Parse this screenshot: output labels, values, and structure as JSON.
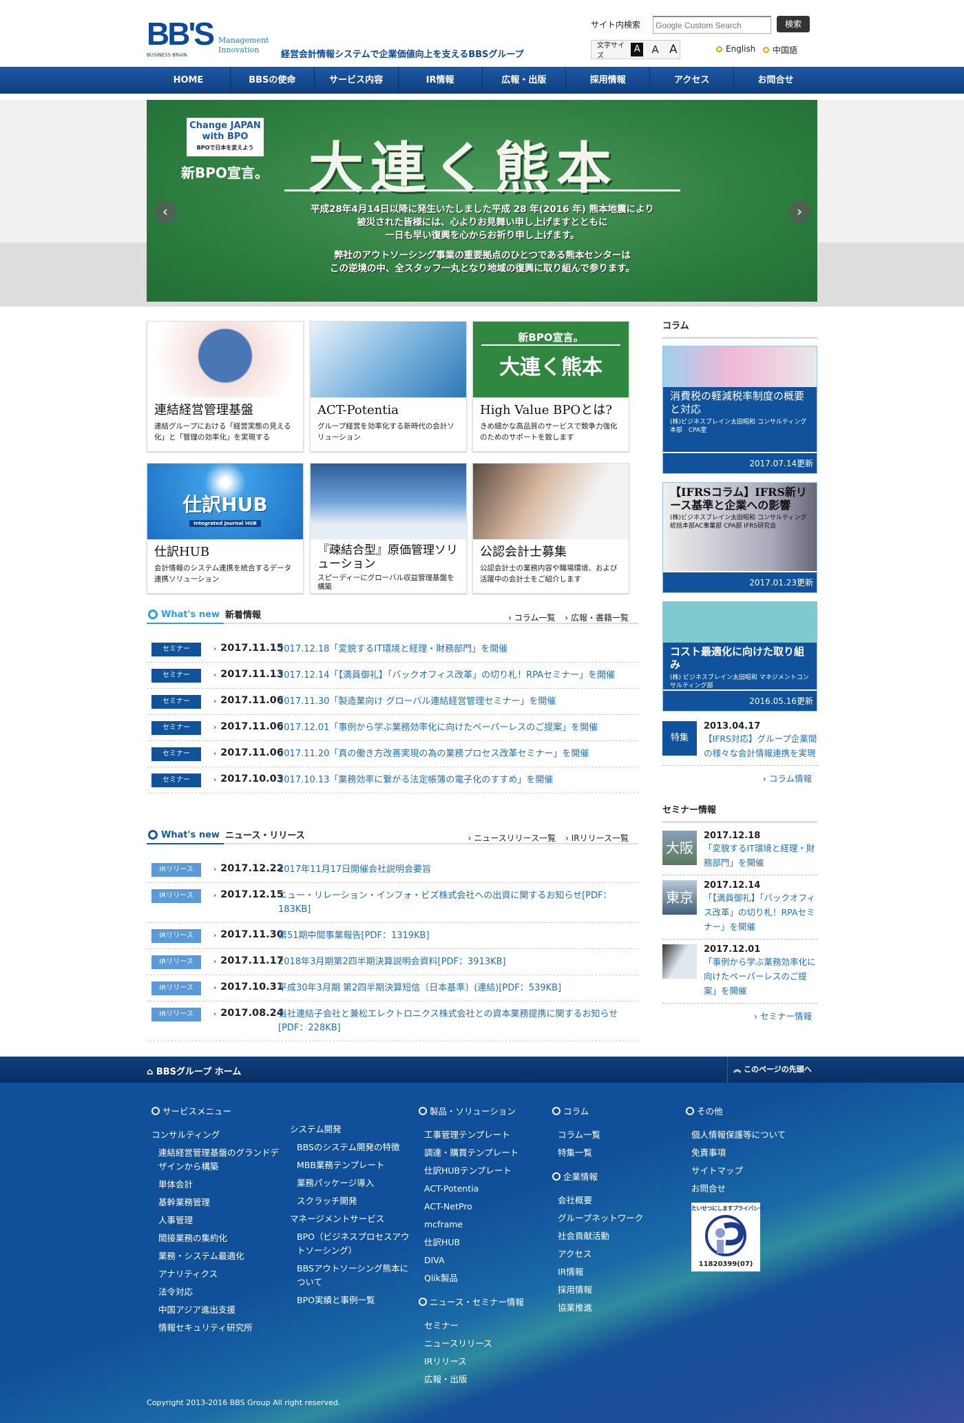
{
  "header": {
    "logo_text": "BB'S",
    "logo_sub": "BUSINESS BRAIN",
    "logo_tag": "Management Innovation",
    "tagline": "経営会計情報システムで企業価値向上を支えるBBSグループ",
    "search_label": "サイト内検索",
    "search_placeholder": "Google Custom Search",
    "search_button": "検索",
    "font_size_label": "文字サイズ",
    "font_sizes": [
      "A",
      "A",
      "A"
    ],
    "lang_en": "English",
    "lang_cn": "中国語"
  },
  "nav": [
    "HOME",
    "BBSの使命",
    "サービス内容",
    "IR情報",
    "広報・出版",
    "採用情報",
    "アクセス",
    "お問合せ"
  ],
  "hero": {
    "badge_line1": "Change JAPAN",
    "badge_line2": "with BPO",
    "badge_small": "BPOで日本を変えよう",
    "sub_title": "新BPO宣言。",
    "title": "大連く熊本",
    "message_1": "平成28年4月14日以降に発生いたしました平成 28 年(2016 年) 熊本地震により",
    "message_2": "被災された皆様には、心よりお見舞い申し上げますとともに",
    "message_3": "一日も早い復興を心からお祈り申し上げます。",
    "message_4": "弊社のアウトソーシング事業の重要拠点のひとつである熊本センターは",
    "message_5": "この逆境の中、全スタッフ一丸となり地域の復興に取り組んで参ります。",
    "prev": "‹",
    "next": "›",
    "slide_count": 8,
    "active_slide": 2
  },
  "tiles": [
    {
      "title": "連結経営管理基盤",
      "desc": "連結グループにおける「経営実態の見える化」と「管理の効率化」を実現する"
    },
    {
      "title": "ACT-Potentia",
      "desc": "グループ経営を効率化する新時代の会計ソリューション"
    },
    {
      "title": "High Value BPOとは?",
      "desc": "きめ細かな高品質のサービスで競争力強化のためのサポートを致します",
      "img_text_1": "新BPO宣言。",
      "img_text_2": "大連く熊本"
    },
    {
      "title": "仕訳HUB",
      "desc": "会計情報のシステム連携を統合するデータ連携ソリューション",
      "img_text": "仕訳HUB",
      "img_sub": "Integrated Journal HUB"
    },
    {
      "title": "『疎結合型』原価管理ソリューション",
      "desc": "スピーディーにグローバル収益管理基盤を構築"
    },
    {
      "title": "公認会計士募集",
      "desc": "公認会計士の業務内容や職場環境、および活躍中の会計士をご紹介します"
    }
  ],
  "whats_new": {
    "label": "What's new",
    "title": "新着情報",
    "links": [
      "コラム一覧",
      "広報・書籍一覧"
    ],
    "badge_color": "#10539c",
    "items": [
      {
        "badge": "セミナー",
        "date": "2017.11.15",
        "title": "2017.12.18「変貌するIT環境と経理・財務部門」を開催"
      },
      {
        "badge": "セミナー",
        "date": "2017.11.13",
        "title": "2017.12.14「【満員御礼】「バックオフィス改革」の切り札！RPAセミナー」を開催"
      },
      {
        "badge": "セミナー",
        "date": "2017.11.06",
        "title": "2017.11.30「製造業向け グローバル連結経営管理セミナー」を開催"
      },
      {
        "badge": "セミナー",
        "date": "2017.11.06",
        "title": "2017.12.01「事例から学ぶ業務効率化に向けたペーパーレスのご提案」を開催"
      },
      {
        "badge": "セミナー",
        "date": "2017.11.06",
        "title": "2017.11.20「真の働き方改善実現の為の業務プロセス改革セミナー」を開催"
      },
      {
        "badge": "セミナー",
        "date": "2017.10.03",
        "title": "2017.10.13「業務効率に繋がる法定帳簿の電子化のすすめ」を開催"
      }
    ]
  },
  "news": {
    "label": "What's new",
    "title": "ニュース・リリース",
    "links": [
      "ニュースリリース一覧",
      "IRリリース一覧"
    ],
    "badge_color": "#5a9ad8",
    "items": [
      {
        "badge": "IRリリース",
        "date": "2017.12.22",
        "title": "2017年11月17日開催会社説明会要旨"
      },
      {
        "badge": "IRリリース",
        "date": "2017.12.15",
        "title": "ニュー・リレーション・インフォ・ビズ株式会社への出資に関するお知らせ[PDF：183KB]"
      },
      {
        "badge": "IRリリース",
        "date": "2017.11.30",
        "title": "第51期中間事業報告[PDF：1319KB]"
      },
      {
        "badge": "IRリリース",
        "date": "2017.11.17",
        "title": "2018年3月期第2四半期決算説明会資料[PDF：3913KB]"
      },
      {
        "badge": "IRリリース",
        "date": "2017.10.31",
        "title": "平成30年3月期 第2四半期決算短信〔日本基準〕(連結)[PDF：539KB]"
      },
      {
        "badge": "IRリリース",
        "date": "2017.08.24",
        "title": "当社連結子会社と兼松エレクトロニクス株式会社との資本業務提携に関するお知らせ[PDF：228KB]"
      }
    ]
  },
  "sidebar": {
    "column_heading": "コラム",
    "columns": [
      {
        "title": "消費税の軽減税率制度の概要と対応",
        "author": "(株)ビジネスブレイン太田昭和 コンサルティング本部　CPA室",
        "date": "2017.07.14更新"
      },
      {
        "title": "【IFRSコラム】IFRS新リース基準と企業への影響",
        "author": "(株)ビジネスブレイン太田昭和 コンサルティング統括本部AC事業部 CPA部 IFRS研究会",
        "date": "2017.01.23更新"
      },
      {
        "title": "コスト最適化に向けた取り組み",
        "author": "(株) ビジネスブレイン太田昭和 マネジメントコンサルティング部",
        "date": "2016.05.16更新"
      }
    ],
    "feature": {
      "badge": "特集",
      "date": "2013.04.17",
      "title": "【IFRS対応】グループ企業間の様々な会計情報連携を実現"
    },
    "column_more": "コラム情報",
    "seminar_heading": "セミナー情報",
    "seminars": [
      {
        "thumb": "大阪",
        "date": "2017.12.18",
        "title": "「変貌するIT環境と経理・財務部門」を開催"
      },
      {
        "thumb": "東京",
        "date": "2017.12.14",
        "title": "「【満員御礼】「バックオフィス改革」の切り札！RPAセミナー」を開催"
      },
      {
        "thumb": "",
        "date": "2017.12.01",
        "title": "「事例から学ぶ業務効率化に向けたペーパーレスのご提案」を開催"
      }
    ],
    "seminar_more": "セミナー情報"
  },
  "footer": {
    "home": "BBSグループ ホーム",
    "to_top": "このページの先頭へ",
    "service_heading": "サービスメニュー",
    "service_col1": [
      {
        "t": "コンサルティング",
        "s": false
      },
      {
        "t": "連結経営管理基盤のグランドデザインから構築",
        "s": true
      },
      {
        "t": "単体会計",
        "s": true
      },
      {
        "t": "基幹業務管理",
        "s": true
      },
      {
        "t": "人事管理",
        "s": true
      },
      {
        "t": "間接業務の集約化",
        "s": true
      },
      {
        "t": "業務・システム最適化",
        "s": true
      },
      {
        "t": "アナリティクス",
        "s": true
      },
      {
        "t": "法令対応",
        "s": true
      },
      {
        "t": "中国アジア進出支援",
        "s": true
      },
      {
        "t": "情報セキュリティ研究所",
        "s": true
      }
    ],
    "service_col2": [
      {
        "t": "システム開発",
        "s": false
      },
      {
        "t": "BBSのシステム開発の特徴",
        "s": true
      },
      {
        "t": "MBB業務テンプレート",
        "s": true
      },
      {
        "t": "業務パッケージ導入",
        "s": true
      },
      {
        "t": "スクラッチ開発",
        "s": true
      },
      {
        "t": "マネージメントサービス",
        "s": false
      },
      {
        "t": "BPO（ビジネスプロセスアウトソーシング）",
        "s": true
      },
      {
        "t": "BBSアウトソーシング熊本について",
        "s": true
      },
      {
        "t": "BPO実績と事例一覧",
        "s": true
      }
    ],
    "products_heading": "製品・ソリューション",
    "products": [
      "工事管理テンプレート",
      "調達・購買テンプレート",
      "仕訳HUBテンプレート",
      "ACT-Potentia",
      "ACT-NetPro",
      "mcframe",
      "仕訳HUB",
      "DIVA",
      "Qlik製品"
    ],
    "news_heading": "ニュース・セミナー情報",
    "news": [
      "セミナー",
      "ニュースリリース",
      "IRリリース",
      "広報・出版"
    ],
    "column_heading": "コラム",
    "column": [
      "コラム一覧",
      "特集一覧"
    ],
    "corp_heading": "企業情報",
    "corp": [
      "会社概要",
      "グループネットワーク",
      "社会貢献活動",
      "アクセス",
      "IR情報",
      "採用情報",
      "協業推進"
    ],
    "other_heading": "その他",
    "other": [
      "個人情報保護等について",
      "免責事項",
      "サイトマップ",
      "お問合せ"
    ],
    "privacy_mark_text": "たいせつにしますプライバシー",
    "privacy_mark_number": "11820399(07)",
    "copyright": "Copyright 2013-2016 BBS Group All right reserved."
  }
}
